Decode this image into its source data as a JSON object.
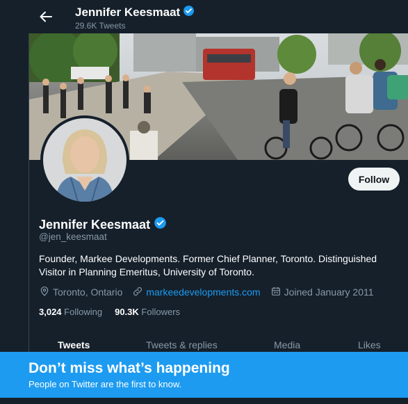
{
  "header": {
    "back_icon": "arrow-left-icon",
    "name": "Jennifer Keesmaat",
    "tweet_count": "29.6K Tweets",
    "verified_icon": "verified-badge-icon"
  },
  "banner": {
    "description_icon": "street-photo"
  },
  "profile": {
    "follow_label": "Follow",
    "name": "Jennifer Keesmaat",
    "handle": "@jen_keesmaat",
    "bio": "Founder, Markee Developments. Former Chief Planner, Toronto. Distinguished Visitor in Planning Emeritus, University of Toronto.",
    "location": "Toronto, Ontario",
    "website": "markeedevelopments.com",
    "joined": "Joined January 2011",
    "following_count": "3,024",
    "following_label": "Following",
    "followers_count": "90.3K",
    "followers_label": "Followers"
  },
  "tabs": [
    {
      "label": "Tweets"
    },
    {
      "label": "Tweets & replies"
    },
    {
      "label": "Media"
    },
    {
      "label": "Likes"
    }
  ],
  "cta": {
    "title": "Don’t miss what’s happening",
    "subtitle": "People on Twitter are the first to know."
  },
  "colors": {
    "background": "#15202b",
    "accent": "#1d9bf0",
    "secondary_text": "#8899a6"
  }
}
